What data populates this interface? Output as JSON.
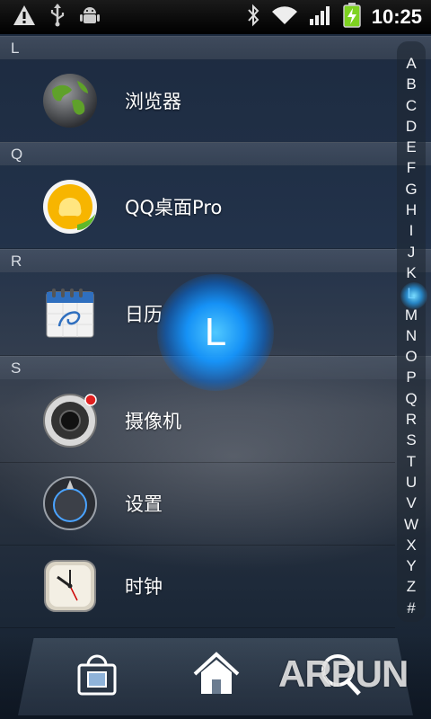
{
  "status_bar": {
    "time": "10:25",
    "icons": [
      "warning-icon",
      "usb-icon",
      "android-debug-icon",
      "bluetooth-icon",
      "wifi-icon",
      "signal-icon",
      "battery-charging-icon"
    ]
  },
  "sections": [
    {
      "letter": "L",
      "apps": [
        {
          "name": "浏览器",
          "icon": "browser-globe-icon"
        }
      ]
    },
    {
      "letter": "Q",
      "apps": [
        {
          "name": "QQ桌面Pro",
          "icon": "qq-penguin-icon"
        }
      ]
    },
    {
      "letter": "R",
      "apps": [
        {
          "name": "日历",
          "icon": "calendar-icon"
        }
      ]
    },
    {
      "letter": "S",
      "apps": [
        {
          "name": "摄像机",
          "icon": "camcorder-icon"
        },
        {
          "name": "设置",
          "icon": "settings-icon"
        },
        {
          "name": "时钟",
          "icon": "clock-icon"
        }
      ]
    }
  ],
  "index_letters": [
    "A",
    "B",
    "C",
    "D",
    "E",
    "F",
    "G",
    "H",
    "I",
    "J",
    "K",
    "L",
    "M",
    "N",
    "O",
    "P",
    "Q",
    "R",
    "S",
    "T",
    "U",
    "V",
    "W",
    "X",
    "Y",
    "Z",
    "#"
  ],
  "current_letter_overlay": "L",
  "dock": {
    "icons": [
      "market-bag-icon",
      "home-icon",
      "search-icon"
    ]
  },
  "watermark": "ARPUN",
  "colors": {
    "accent_glow": "#1e9bff",
    "status_bar": "#000000",
    "battery_green": "#7ed321"
  }
}
